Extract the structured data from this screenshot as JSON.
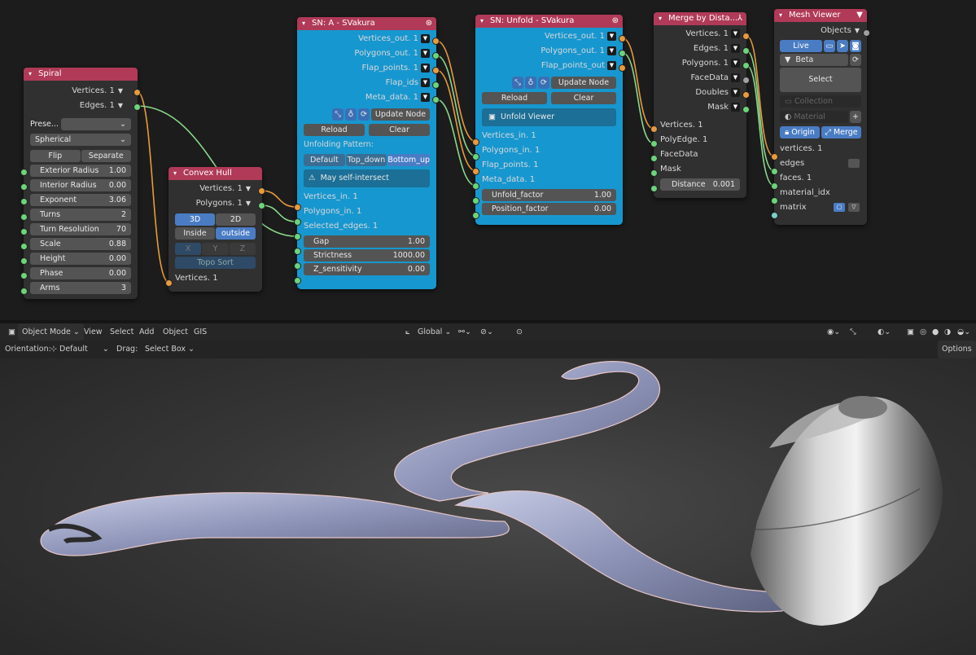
{
  "spiral": {
    "title": "Spiral",
    "out_vertices": "Vertices. 1",
    "out_edges": "Edges. 1",
    "preset": "Prese...",
    "mode": "Spherical",
    "flip": "Flip",
    "separate": "Separate",
    "fields": [
      {
        "label": "Exterior Radius",
        "value": "1.00"
      },
      {
        "label": "Interior Radius",
        "value": "0.00"
      },
      {
        "label": "Exponent",
        "value": "3.06"
      },
      {
        "label": "Turns",
        "value": "2"
      },
      {
        "label": "Turn Resolution",
        "value": "70"
      },
      {
        "label": "Scale",
        "value": "0.88"
      },
      {
        "label": "Height",
        "value": "0.00"
      },
      {
        "label": "Phase",
        "value": "0.00"
      },
      {
        "label": "Arms",
        "value": "3"
      }
    ]
  },
  "convex": {
    "title": "Convex Hull",
    "out_vertices": "Vertices. 1",
    "out_polygons": "Polygons. 1",
    "b3d": "3D",
    "b2d": "2D",
    "inside": "Inside",
    "outside": "outside",
    "x": "X",
    "y": "Y",
    "z": "Z",
    "topo": "Topo Sort",
    "in_vertices": "Vertices. 1"
  },
  "svakura": {
    "title": "SN: A - SVakura",
    "outputs": [
      "Vertices_out. 1",
      "Polygons_out. 1",
      "Flap_points. 1",
      "Flap_ids",
      "Meta_data. 1"
    ],
    "update": "Update Node",
    "reload": "Reload",
    "clear": "Clear",
    "pattern_label": "Unfolding Pattern:",
    "pattern_opts": [
      "Default",
      "Top_down",
      "Bottom_up"
    ],
    "warning": "May self-intersect",
    "inputs": [
      "Vertices_in. 1",
      "Polygons_in. 1",
      "Selected_edges. 1"
    ],
    "fields": [
      {
        "label": "Gap",
        "value": "1.00"
      },
      {
        "label": "Strictness",
        "value": "1000.00"
      },
      {
        "label": "Z_sensitivity",
        "value": "0.00"
      }
    ]
  },
  "unfold": {
    "title": "SN: Unfold - SVakura",
    "outputs": [
      "Vertices_out. 1",
      "Polygons_out. 1",
      "Flap_points_out"
    ],
    "update": "Update Node",
    "reload": "Reload",
    "clear": "Clear",
    "viewer": "Unfold Viewer",
    "inputs": [
      "Vertices_in. 1",
      "Polygons_in. 1",
      "Flap_points. 1",
      "Meta_data. 1"
    ],
    "fields": [
      {
        "label": "Unfold_factor",
        "value": "1.00"
      },
      {
        "label": "Position_factor",
        "value": "0.00"
      }
    ]
  },
  "merge": {
    "title": "Merge by Dista...",
    "outputs": [
      "Vertices. 1",
      "Edges. 1",
      "Polygons. 1",
      "FaceData",
      "Doubles",
      "Mask"
    ],
    "inputs": [
      "Vertices. 1",
      "PolyEdge. 1",
      "FaceData",
      "Mask"
    ],
    "distance_label": "Distance",
    "distance_value": "0.001"
  },
  "viewer": {
    "title": "Mesh Viewer",
    "objects": "Objects",
    "live": "Live",
    "name": "Beta",
    "select": "Select",
    "collection": "Collection",
    "material": "Material",
    "origin": "Origin",
    "merge": "Merge",
    "inputs": [
      "vertices. 1",
      "edges",
      "faces. 1",
      "material_idx",
      "matrix"
    ]
  },
  "vp": {
    "mode": "Object Mode",
    "menus": [
      "View",
      "Select",
      "Add",
      "Object",
      "GIS"
    ],
    "transform": "Global",
    "orientation_label": "Orientation:",
    "orientation": "Default",
    "drag_label": "Drag:",
    "drag": "Select Box",
    "options": "Options"
  }
}
